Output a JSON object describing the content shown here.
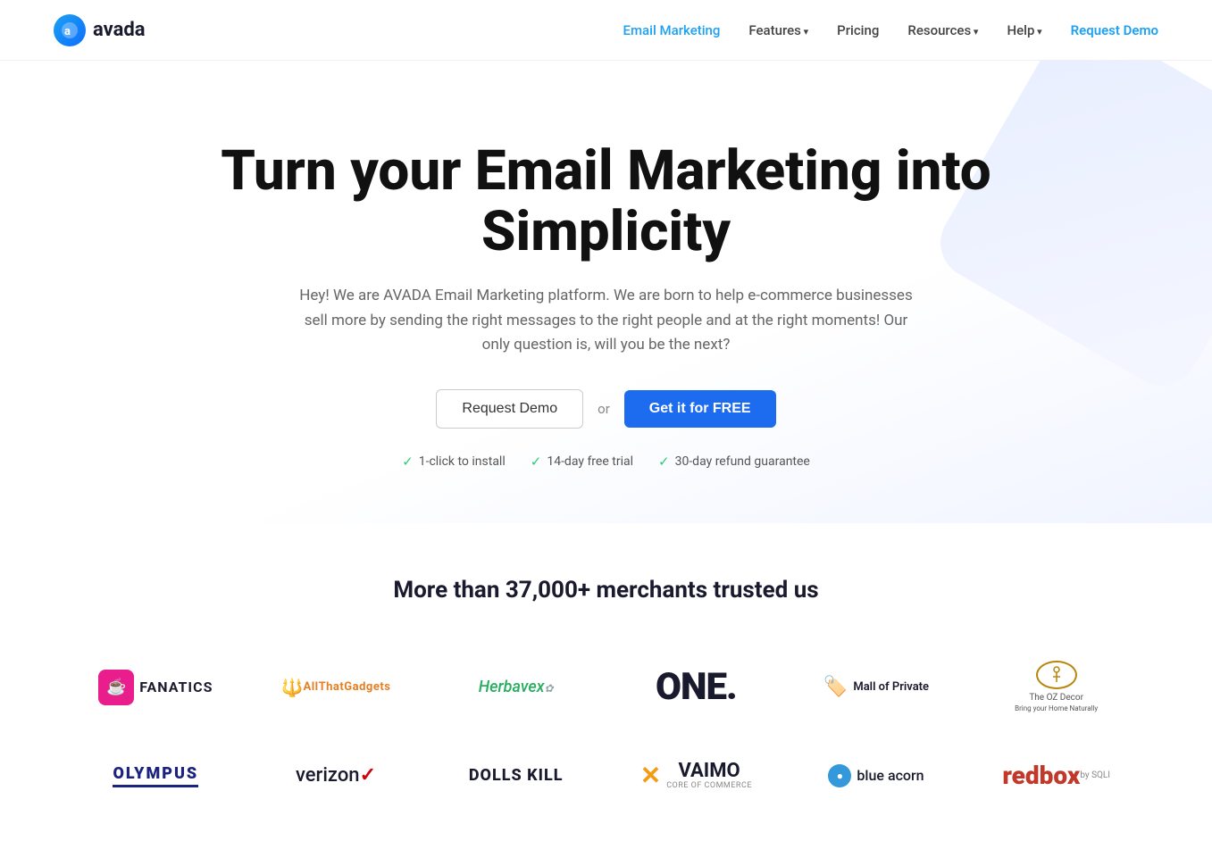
{
  "nav": {
    "logo_letter": "a",
    "logo_text": "avada",
    "links": [
      {
        "id": "email-marketing",
        "label": "Email Marketing",
        "active": true,
        "has_arrow": false
      },
      {
        "id": "features",
        "label": "Features",
        "active": false,
        "has_arrow": true
      },
      {
        "id": "pricing",
        "label": "Pricing",
        "active": false,
        "has_arrow": false
      },
      {
        "id": "resources",
        "label": "Resources",
        "active": false,
        "has_arrow": true
      },
      {
        "id": "help",
        "label": "Help",
        "active": false,
        "has_arrow": true
      },
      {
        "id": "request-demo",
        "label": "Request Demo",
        "active": false,
        "has_arrow": false,
        "highlight": true
      }
    ]
  },
  "hero": {
    "heading": "Turn your Email Marketing into Simplicity",
    "subtext": "Hey! We are AVADA Email Marketing platform. We are born to help e-commerce businesses sell more by sending the right messages to the right people and at the right moments! Our only question is, will you be the next?",
    "btn_demo": "Request Demo",
    "btn_or": "or",
    "btn_free": "Get it for FREE",
    "badge1": "1-click to install",
    "badge2": "14-day free trial",
    "badge3": "30-day refund guarantee"
  },
  "trusted": {
    "heading": "More than 37,000+ merchants trusted us",
    "brands": [
      {
        "id": "fanatics",
        "name": "Fanatics"
      },
      {
        "id": "allthat",
        "name": "AllThatGadgets"
      },
      {
        "id": "herbavex",
        "name": "Herbavex"
      },
      {
        "id": "one",
        "name": "ONE."
      },
      {
        "id": "mallofprivate",
        "name": "Mall of Private"
      },
      {
        "id": "ozdecor",
        "name": "The OZ Decor"
      },
      {
        "id": "olympus",
        "name": "OLYMPUS"
      },
      {
        "id": "verizon",
        "name": "verizon"
      },
      {
        "id": "dollskill",
        "name": "DOLLS KILL"
      },
      {
        "id": "vaimo",
        "name": "VAIMO"
      },
      {
        "id": "blueacorn",
        "name": "blue acorn"
      },
      {
        "id": "redbox",
        "name": "redbox"
      }
    ]
  },
  "colors": {
    "accent_blue": "#1d6cf0",
    "active_nav": "#1da1f2",
    "green_check": "#2ecc71"
  }
}
